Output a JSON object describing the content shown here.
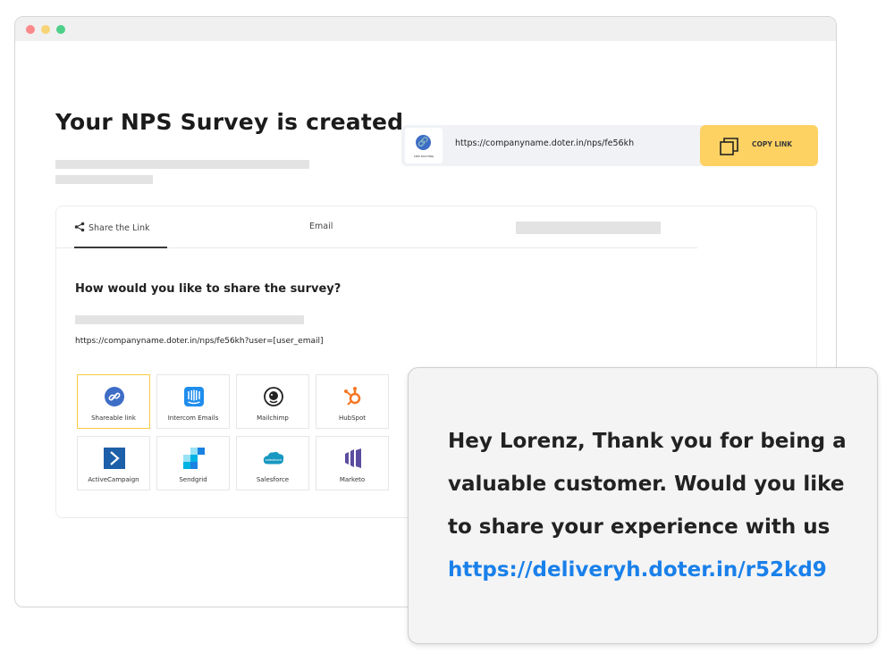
{
  "page": {
    "title": "Your NPS Survey is created"
  },
  "linkbar": {
    "logo_text": "CMD DOCHING",
    "url": "https://companyname.doter.in/nps/fe56kh",
    "copy_label": "COPY LINK"
  },
  "tabs": [
    {
      "label": "Share the Link",
      "active": true
    },
    {
      "label": "Email",
      "active": false
    }
  ],
  "share": {
    "question": "How would you like to share the survey?",
    "url_template": "https://companyname.doter.in/nps/fe56kh?user=[user_email]"
  },
  "integrations": [
    {
      "label": "Shareable link",
      "icon": "link-icon",
      "selected": true
    },
    {
      "label": "Intercom Emails",
      "icon": "intercom-icon"
    },
    {
      "label": "Mailchimp",
      "icon": "mailchimp-icon"
    },
    {
      "label": "HubSpot",
      "icon": "hubspot-icon"
    },
    {
      "label": "ActiveCampaign",
      "icon": "activecampaign-icon"
    },
    {
      "label": "Sendgrid",
      "icon": "sendgrid-icon"
    },
    {
      "label": "Salesforce",
      "icon": "salesforce-icon"
    },
    {
      "label": "Marketo",
      "icon": "marketo-icon"
    }
  ],
  "message": {
    "lines": [
      "Hey Lorenz, Thank you for being a",
      "valuable customer. Would you like",
      "to share your experience with us"
    ],
    "link": "https://deliveryh.doter.in/r52kd9"
  },
  "colors": {
    "accent_yellow": "#fdd263",
    "link_blue": "#1a80ea",
    "brand_blue": "#3d6dc6"
  }
}
